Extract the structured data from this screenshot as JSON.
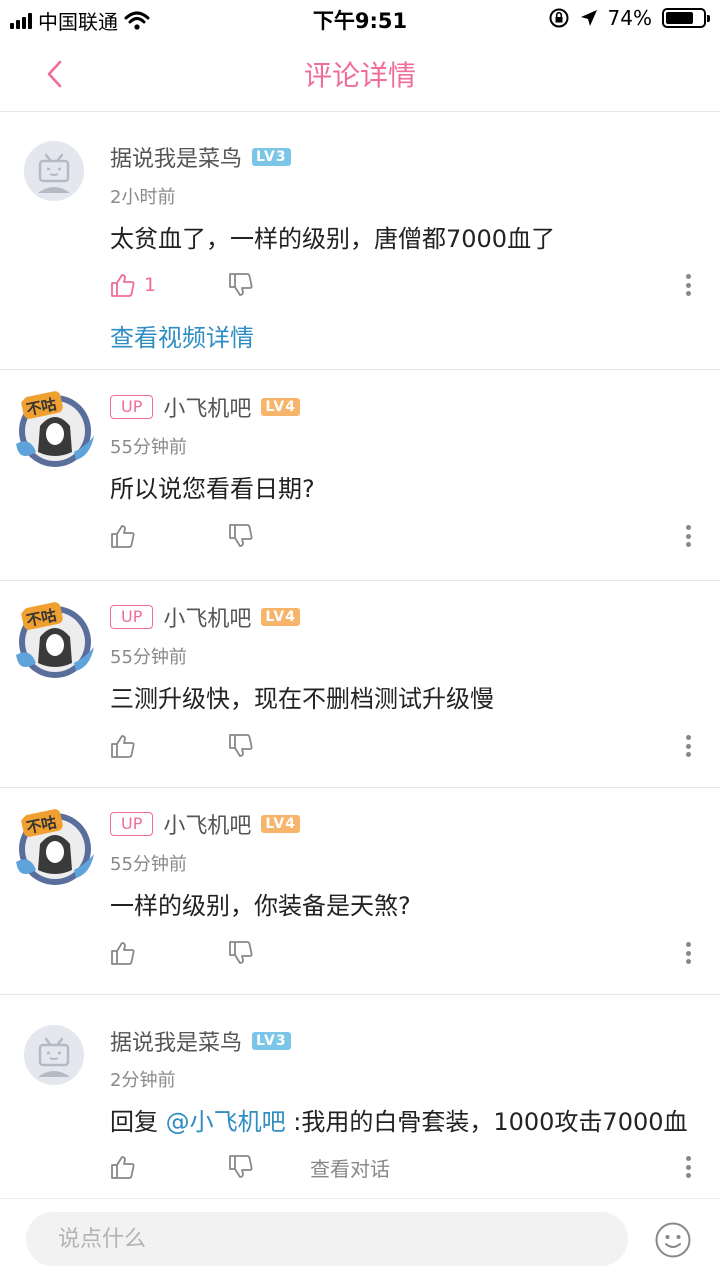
{
  "status_bar": {
    "carrier": "中国联通",
    "time": "下午9:51",
    "battery": "74%",
    "battery_level": 0.74
  },
  "nav": {
    "title": "评论详情"
  },
  "comments": [
    {
      "username": "据说我是菜鸟",
      "level": "LV3",
      "is_up": false,
      "time": "2小时前",
      "text": "太贫血了，一样的级别，唐僧都7000血了",
      "like_count": "1",
      "link": "查看视频详情"
    },
    {
      "username": "小飞机吧",
      "level": "LV4",
      "is_up": true,
      "up_label": "UP",
      "time": "55分钟前",
      "text": "所以说您看看日期?"
    },
    {
      "username": "小飞机吧",
      "level": "LV4",
      "is_up": true,
      "up_label": "UP",
      "time": "55分钟前",
      "text": "三测升级快，现在不删档测试升级慢"
    },
    {
      "username": "小飞机吧",
      "level": "LV4",
      "is_up": true,
      "up_label": "UP",
      "time": "55分钟前",
      "text": "一样的级别，你装备是天煞?"
    },
    {
      "username": "据说我是菜鸟",
      "level": "LV3",
      "is_up": false,
      "time": "2分钟前",
      "reply_prefix": "回复 ",
      "mention": "@小飞机吧",
      "text": " :我用的白骨套装，1000攻击7000血",
      "view_conversation": "查看对话"
    }
  ],
  "input": {
    "placeholder": "说点什么"
  },
  "colors": {
    "accent": "#f06d97",
    "link": "#2e8ec2",
    "level_blue": "#7bc6e8",
    "level_orange": "#f7b46b"
  },
  "icons": [
    "signal-icon",
    "wifi-icon",
    "lock-rotation-icon",
    "location-icon",
    "battery-icon",
    "back-chevron-icon",
    "thumb-up-icon",
    "thumb-down-icon",
    "more-dots-icon",
    "emoji-icon",
    "default-avatar-icon",
    "up-avatar-icon"
  ]
}
